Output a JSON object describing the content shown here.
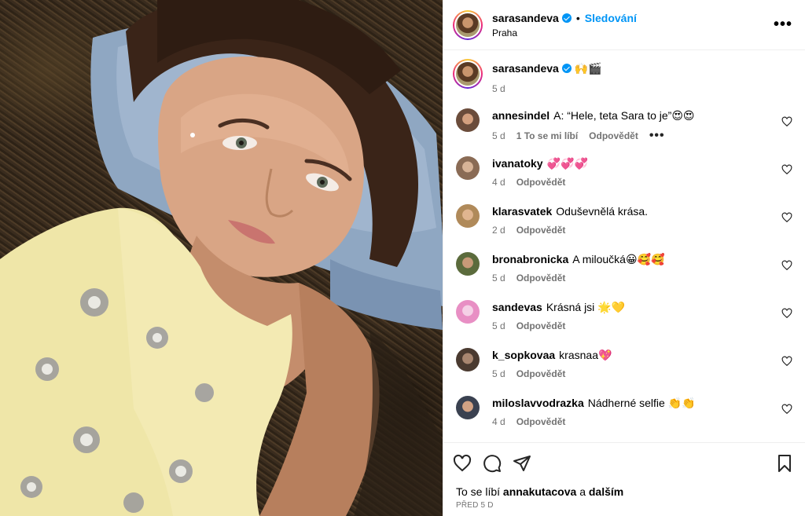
{
  "header": {
    "username": "sarasandeva",
    "separator": "•",
    "follow_label": "Sledování",
    "location": "Praha",
    "more_label": "•••"
  },
  "caption": {
    "username": "sarasandeva",
    "text": "🙌🎬",
    "age": "5 d"
  },
  "comments": [
    {
      "username": "annesindel",
      "text": "A: “Hele, teta Sara to je”😍😍",
      "age": "5 d",
      "likes": "1 To se mi líbí",
      "reply": "Odpovědět",
      "more": "•••",
      "avatar_color": "#6b4c3b"
    },
    {
      "username": "ivanatoky",
      "text": "💞💞💞",
      "age": "4 d",
      "reply": "Odpovědět",
      "avatar_color": "#8a6b55"
    },
    {
      "username": "klarasvatek",
      "text": "Oduševnělá krása.",
      "age": "2 d",
      "reply": "Odpovědět",
      "avatar_color": "#b08a5a"
    },
    {
      "username": "bronabronicka",
      "text": "A miloučká😀🥰🥰",
      "age": "5 d",
      "reply": "Odpovědět",
      "avatar_color": "#5b6b3c"
    },
    {
      "username": "sandevas",
      "text": "Krásná jsi 🌟💛",
      "age": "5 d",
      "reply": "Odpovědět",
      "avatar_color": "#e88fc4"
    },
    {
      "username": "k_sopkovaa",
      "text": "krasnaa💖",
      "age": "5 d",
      "reply": "Odpovědět",
      "avatar_color": "#4a3a30"
    },
    {
      "username": "miloslavvodrazka",
      "text": "Nádherné selfie 👏👏",
      "age": "4 d",
      "reply": "Odpovědět",
      "avatar_color": "#3a4150"
    }
  ],
  "footer": {
    "likes_prefix": "To se líbí",
    "liked_by": "annakutacova",
    "conj": "a",
    "others": "dalším",
    "date": "PŘED 5 D"
  }
}
